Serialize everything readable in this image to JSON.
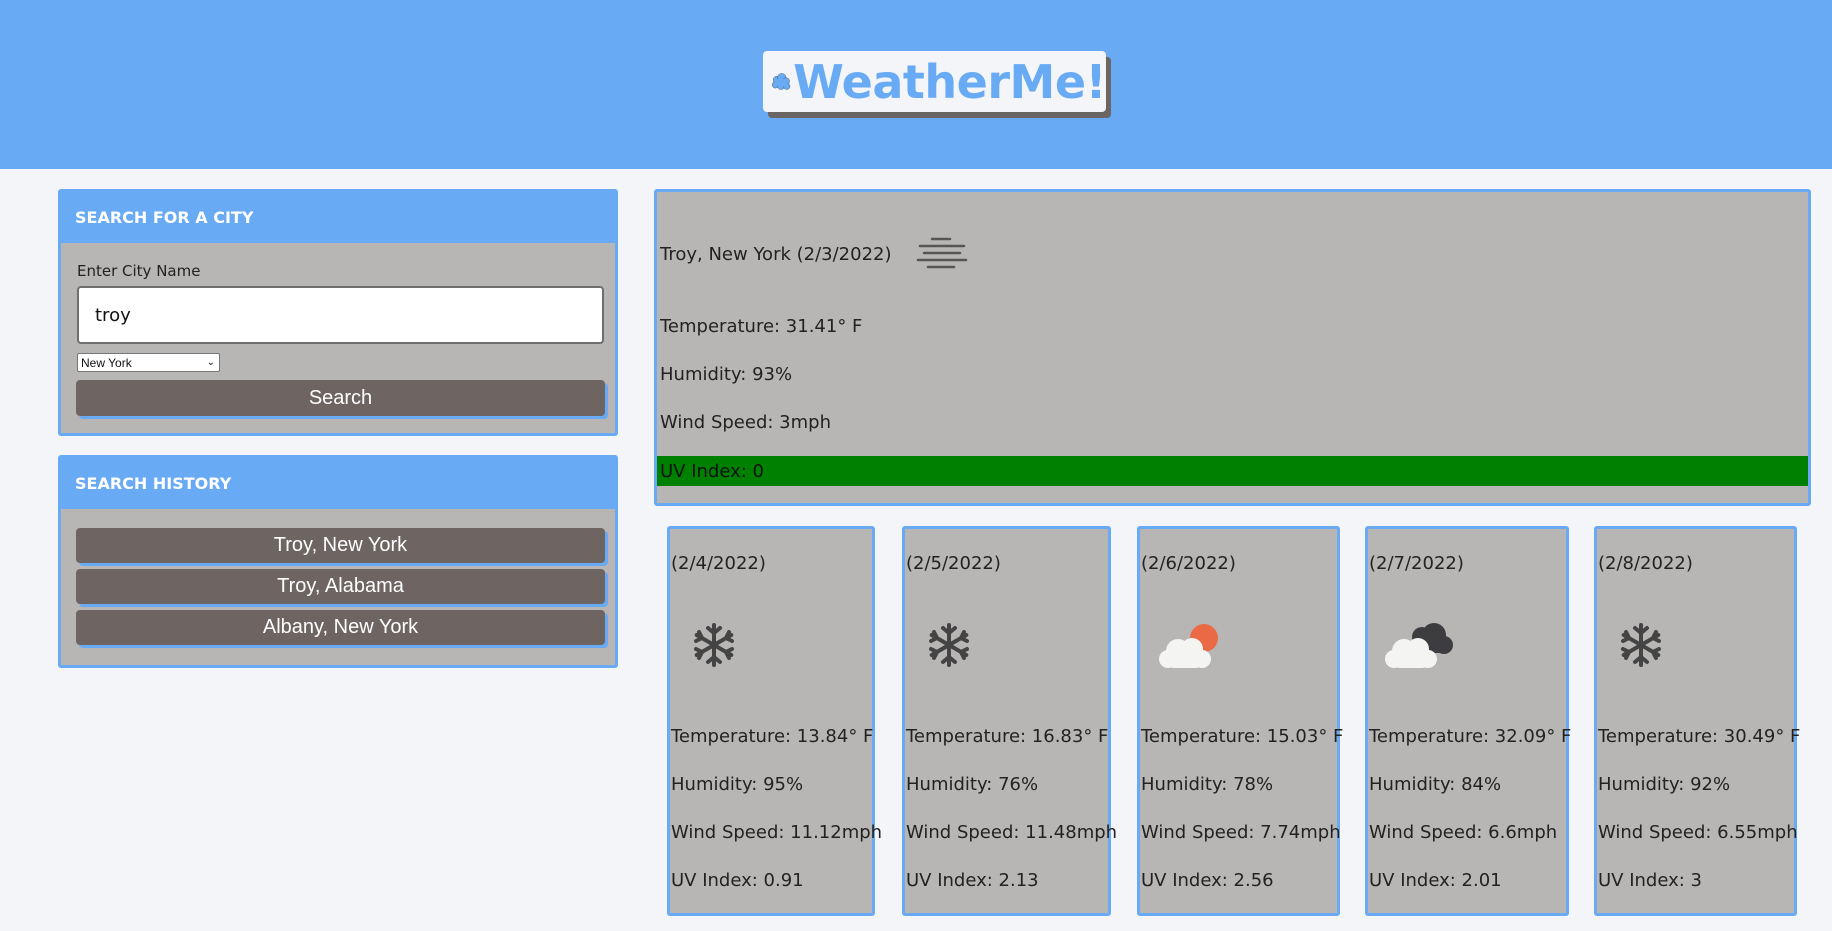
{
  "header": {
    "title": "WeatherMe!",
    "logo_icon": "cloud-icon",
    "brand_color": "#68aaf4"
  },
  "search": {
    "heading": "SEARCH FOR A CITY",
    "label": "Enter City Name",
    "value": "troy",
    "state_selected": "New York",
    "button": "Search"
  },
  "history": {
    "heading": "SEARCH HISTORY",
    "items": [
      "Troy, New York",
      "Troy, Alabama",
      "Albany, New York"
    ]
  },
  "current": {
    "title": "Troy, New York (2/3/2022)",
    "icon": "fog-icon",
    "temperature": "Temperature: 31.41° F",
    "humidity": "Humidity: 93%",
    "wind": "Wind Speed: 3mph",
    "uv": "UV Index: 0",
    "uv_color": "#008000"
  },
  "forecast": [
    {
      "date": "(2/4/2022)",
      "icon": "snowflake-icon",
      "temperature": "Temperature: 13.84° F",
      "humidity": "Humidity: 95%",
      "wind": "Wind Speed: 11.12mph",
      "uv": "UV Index: 0.91"
    },
    {
      "date": "(2/5/2022)",
      "icon": "snowflake-icon",
      "temperature": "Temperature: 16.83° F",
      "humidity": "Humidity: 76%",
      "wind": "Wind Speed: 11.48mph",
      "uv": "UV Index: 2.13"
    },
    {
      "date": "(2/6/2022)",
      "icon": "partly-cloudy-icon",
      "temperature": "Temperature: 15.03° F",
      "humidity": "Humidity: 78%",
      "wind": "Wind Speed: 7.74mph",
      "uv": "UV Index: 2.56"
    },
    {
      "date": "(2/7/2022)",
      "icon": "broken-clouds-icon",
      "temperature": "Temperature: 32.09° F",
      "humidity": "Humidity: 84%",
      "wind": "Wind Speed: 6.6mph",
      "uv": "UV Index: 2.01"
    },
    {
      "date": "(2/8/2022)",
      "icon": "snowflake-icon",
      "temperature": "Temperature: 30.49° F",
      "humidity": "Humidity: 92%",
      "wind": "Wind Speed: 6.55mph",
      "uv": "UV Index: 3"
    }
  ]
}
